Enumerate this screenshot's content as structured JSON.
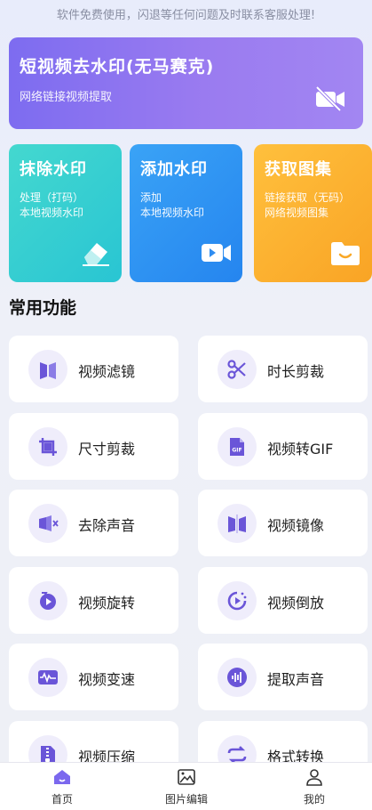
{
  "notice": "软件免费使用，闪退等任何问题及时联系客服处理!",
  "hero": {
    "title": "短视频去水印(无马赛克)",
    "subtitle": "网络链接视频提取",
    "icon": "video-off-icon"
  },
  "cards": [
    {
      "title": "抹除水印",
      "line1": "处理（打码）",
      "line2": "本地视频水印",
      "icon": "eraser-icon",
      "color": "#35cfd1"
    },
    {
      "title": "添加水印",
      "line1": "添加",
      "line2": "本地视频水印",
      "icon": "video-camera-icon",
      "color": "#2f95f3"
    },
    {
      "title": "获取图集",
      "line1": "链接获取（无码）",
      "line2": "网络视频图集",
      "icon": "folder-icon",
      "color": "#fcb132"
    }
  ],
  "section_title": "常用功能",
  "features": [
    {
      "label": "视频滤镜",
      "icon": "filter-icon"
    },
    {
      "label": "时长剪裁",
      "icon": "scissors-icon"
    },
    {
      "label": "尺寸剪裁",
      "icon": "crop-icon"
    },
    {
      "label": "视频转GIF",
      "icon": "gif-icon"
    },
    {
      "label": "去除声音",
      "icon": "mute-icon"
    },
    {
      "label": "视频镜像",
      "icon": "mirror-icon"
    },
    {
      "label": "视频旋转",
      "icon": "rotate-icon"
    },
    {
      "label": "视频倒放",
      "icon": "reverse-icon"
    },
    {
      "label": "视频变速",
      "icon": "speed-icon"
    },
    {
      "label": "提取声音",
      "icon": "audio-extract-icon"
    },
    {
      "label": "视频压缩",
      "icon": "compress-icon"
    },
    {
      "label": "格式转换",
      "icon": "convert-icon"
    }
  ],
  "tabs": [
    {
      "label": "首页",
      "icon": "home-icon",
      "active": true
    },
    {
      "label": "图片编辑",
      "icon": "image-edit-icon",
      "active": false
    },
    {
      "label": "我的",
      "icon": "profile-icon",
      "active": false
    }
  ],
  "colors": {
    "accent": "#7b68ee",
    "icon_bg": "#efedfb",
    "hero": "#8a73f0"
  }
}
